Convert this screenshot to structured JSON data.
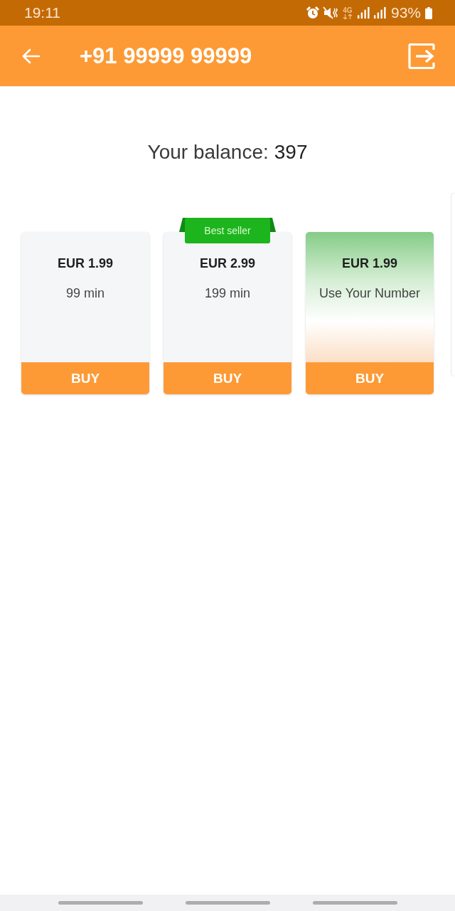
{
  "status_bar": {
    "time": "19:11",
    "network": "4G",
    "battery": "93%"
  },
  "app_bar": {
    "title": "+91 99999 99999"
  },
  "balance": {
    "label": "Your balance:",
    "value": "397"
  },
  "plans": [
    {
      "kind": "plain",
      "price": "EUR 1.99",
      "description": "99 min",
      "button": "BUY"
    },
    {
      "kind": "plain",
      "badge": "Best seller",
      "price": "EUR 2.99",
      "description": "199 min",
      "button": "BUY"
    },
    {
      "kind": "flag",
      "price": "EUR 1.99",
      "description": "Use Your Number",
      "button": "BUY"
    }
  ]
}
